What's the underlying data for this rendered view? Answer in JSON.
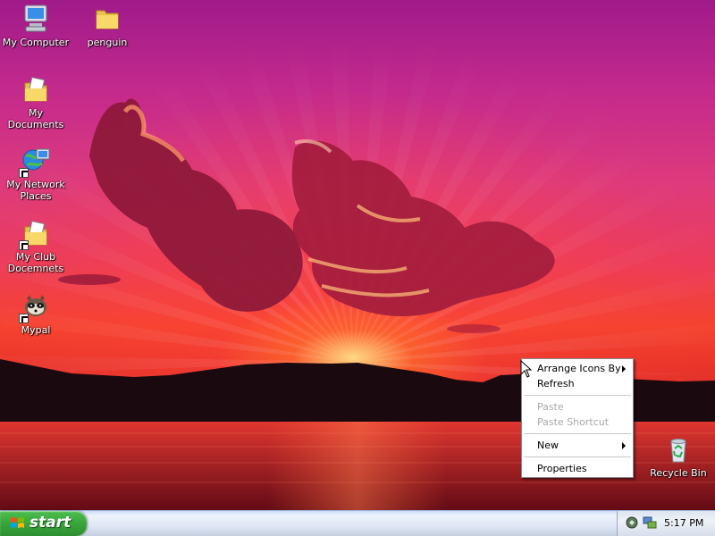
{
  "desktop": {
    "icons": [
      {
        "label": "My Computer"
      },
      {
        "label": "penguin"
      },
      {
        "label": "My Documents"
      },
      {
        "label": "My Network Places"
      },
      {
        "label": "My Club Docemnets"
      },
      {
        "label": "Mypal"
      },
      {
        "label": "Recycle Bin"
      }
    ]
  },
  "context_menu": {
    "items": [
      {
        "label": "Arrange Icons By",
        "enabled": true,
        "submenu": true
      },
      {
        "label": "Refresh",
        "enabled": true
      },
      {
        "label": "Paste",
        "enabled": false
      },
      {
        "label": "Paste Shortcut",
        "enabled": false
      },
      {
        "label": "New",
        "enabled": true,
        "submenu": true
      },
      {
        "label": "Properties",
        "enabled": true
      }
    ]
  },
  "taskbar": {
    "start_label": "start",
    "clock": "5:17 PM",
    "tray_icons": [
      "network-shield-icon",
      "network-connection-icon"
    ]
  },
  "colors": {
    "start_green": "#3aa83c",
    "taskbar_blue": "#dfe7f5",
    "menu_disabled": "#a8a8a8"
  }
}
